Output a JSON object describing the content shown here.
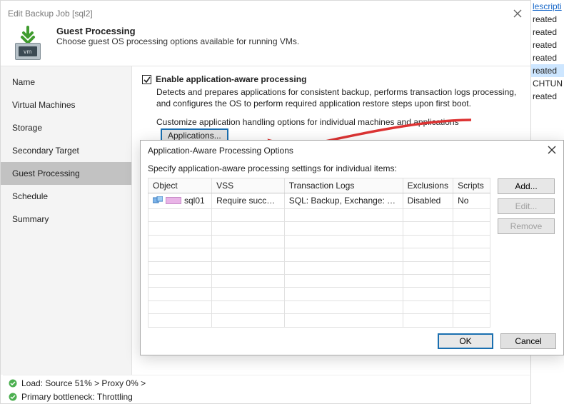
{
  "back": {
    "title": "Edit Backup Job [sql2]",
    "header_title": "Guest Processing",
    "header_sub": "Choose guest OS processing options available for running VMs.",
    "vm_text": "vm"
  },
  "sidebar": {
    "items": [
      {
        "label": "Name"
      },
      {
        "label": "Virtual Machines"
      },
      {
        "label": "Storage"
      },
      {
        "label": "Secondary Target"
      },
      {
        "label": "Guest Processing"
      },
      {
        "label": "Schedule"
      },
      {
        "label": "Summary"
      }
    ],
    "active_index": 4
  },
  "main": {
    "checkbox_label": "Enable application-aware processing",
    "desc1": "Detects and prepares applications for consistent backup, performs transaction logs processing, and configures the OS to perform required application restore steps upon first boot.",
    "desc2": "Customize application handling options for individual machines and applications",
    "applications_button": "Applications..."
  },
  "dialog": {
    "title": "Application-Aware Processing Options",
    "subtext": "Specify application-aware processing settings for individual items:",
    "columns": {
      "object": "Object",
      "vss": "VSS",
      "tl": "Transaction Logs",
      "ex": "Exclusions",
      "sc": "Scripts"
    },
    "row": {
      "object": "sql01",
      "vss": "Require success",
      "tl": "SQL: Backup, Exchange: Tru...",
      "ex": "Disabled",
      "sc": "No"
    },
    "buttons": {
      "add": "Add...",
      "edit": "Edit...",
      "remove": "Remove"
    },
    "footer": {
      "ok": "OK",
      "cancel": "Cancel"
    }
  },
  "status": {
    "line1": "Load: Source 51% > Proxy 0% >",
    "line2": "Primary bottleneck: Throttling"
  },
  "rightstrip": {
    "header": "lescripti",
    "rows": [
      "reated",
      "reated",
      "reated",
      "reated",
      "reated",
      "CHTUN",
      "reated"
    ],
    "selected_index": 4
  }
}
